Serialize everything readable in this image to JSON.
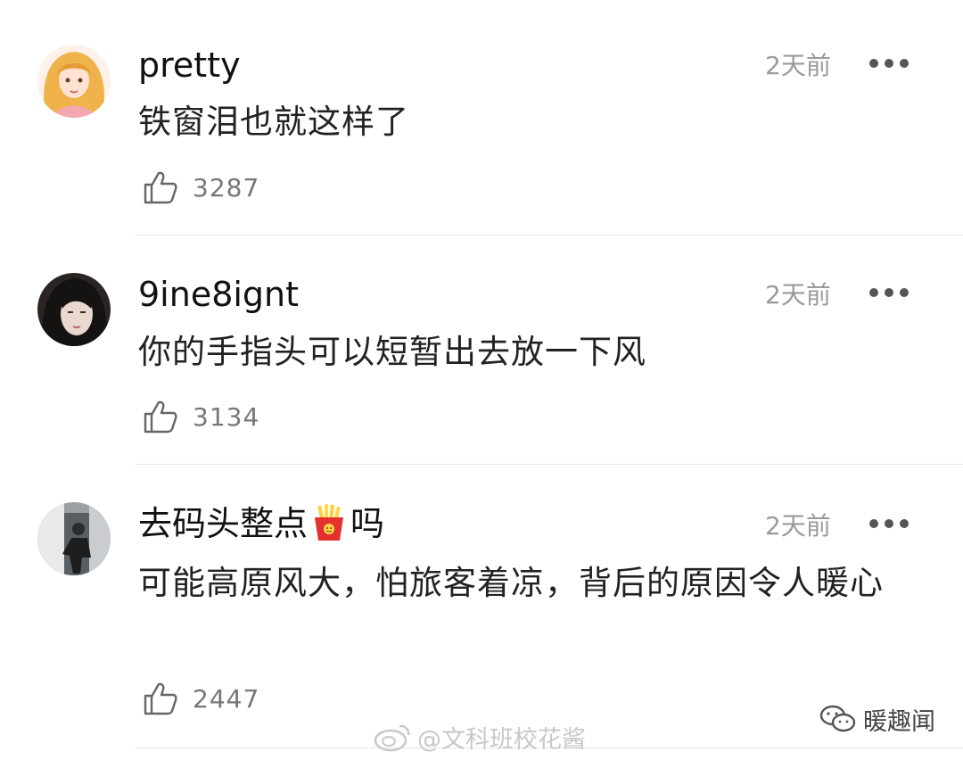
{
  "comments": [
    {
      "username": "pretty",
      "time": "2天前",
      "content": "铁窗泪也就这样了",
      "likes": "3287"
    },
    {
      "username": "9ine8ignt",
      "time": "2天前",
      "content": "你的手指头可以短暂出去放一下风",
      "likes": "3134"
    },
    {
      "username_prefix": "去码头整点",
      "username_suffix": "吗",
      "time": "2天前",
      "content": "可能高原风大，怕旅客着凉，背后的原因令人暖心",
      "likes": "2447"
    }
  ],
  "watermark": "@文科班校花酱",
  "brand": "暖趣闻",
  "icons": {
    "like": "thumbs-up-icon",
    "more": "more-dots-icon",
    "emoji": "french-fries-icon",
    "weibo": "weibo-icon",
    "wechat": "wechat-icon"
  }
}
